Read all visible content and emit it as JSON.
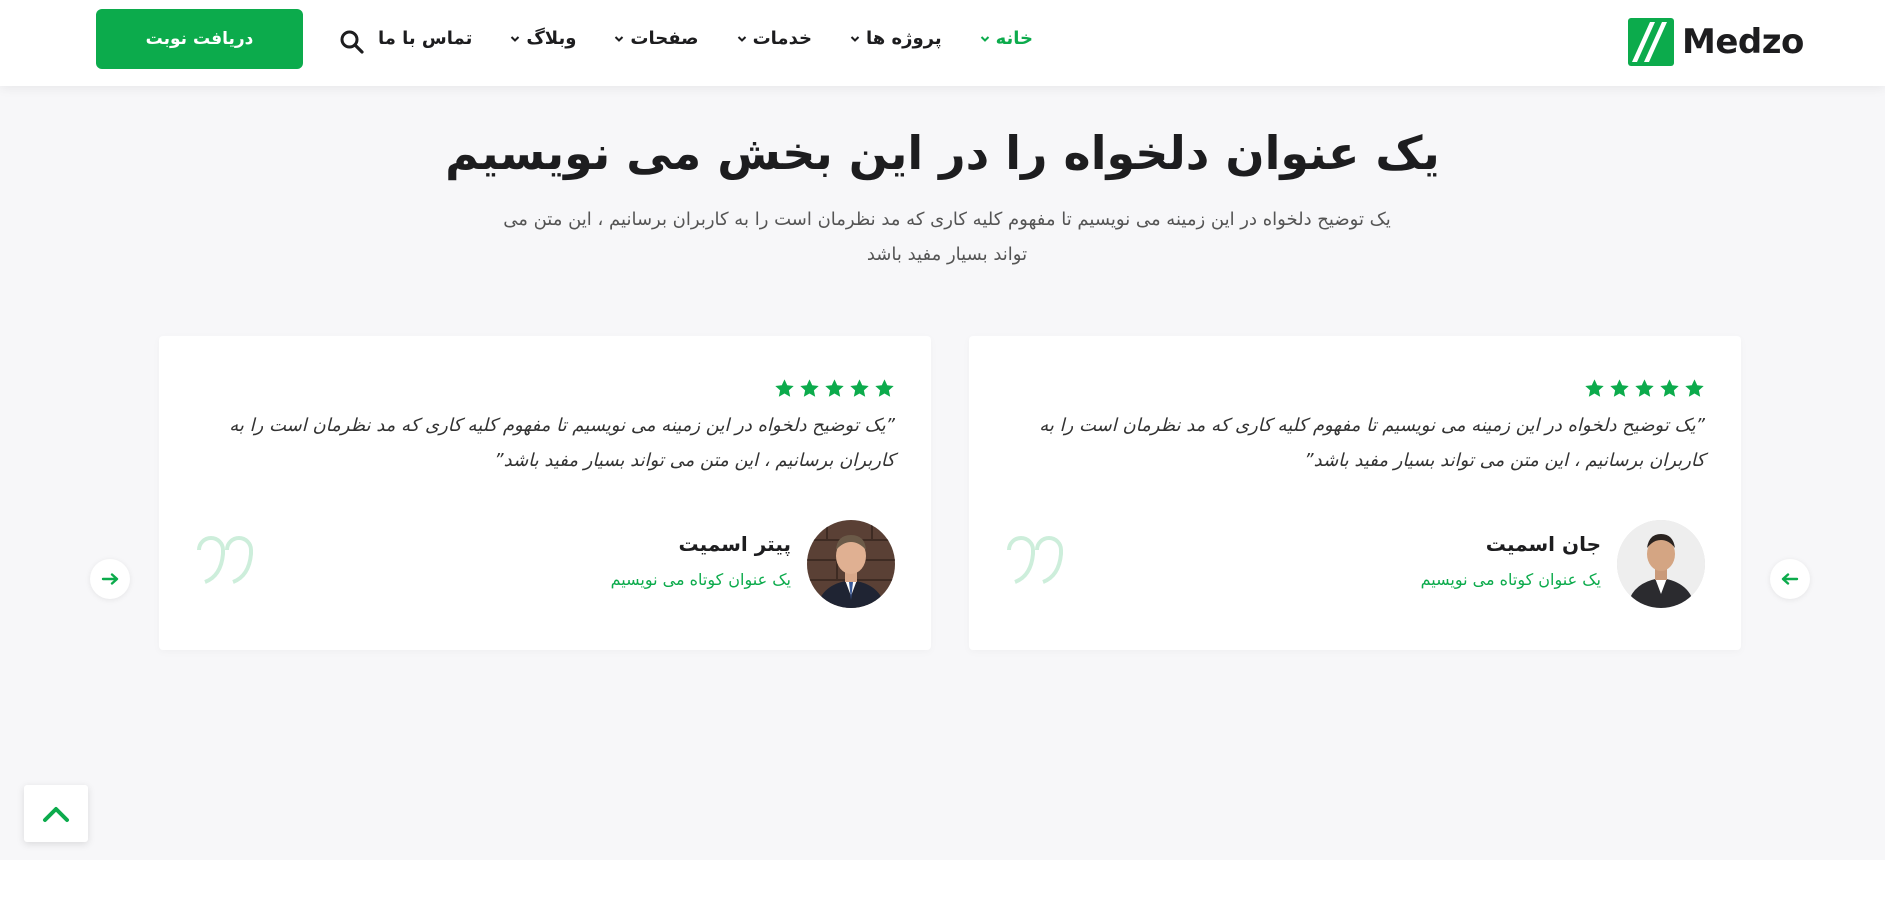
{
  "header": {
    "logo_text": "Medzo",
    "cta_label": "دریافت نوبت",
    "nav": [
      {
        "label": "خانه",
        "dropdown": true,
        "active": true
      },
      {
        "label": "پروژه ها",
        "dropdown": true,
        "active": false
      },
      {
        "label": "خدمات",
        "dropdown": true,
        "active": false
      },
      {
        "label": "صفحات",
        "dropdown": true,
        "active": false
      },
      {
        "label": "وبلاگ",
        "dropdown": true,
        "active": false
      },
      {
        "label": "تماس با ما",
        "dropdown": false,
        "active": false
      }
    ],
    "icons": {
      "search": "search-icon",
      "logo": "medzo-logo-mark"
    }
  },
  "section": {
    "title": "یک عنوان دلخواه را در این بخش می نویسیم",
    "subtitle": "یک توضیح دلخواه در این زمینه می نویسیم تا مفهوم کلیه کاری که مد نظرمان است را به کاربران برسانیم ، این متن می تواند بسیار مفید باشد"
  },
  "testimonials": [
    {
      "rating": 5,
      "quote": "”یک توضیح دلخواه در این زمینه می نویسیم تا مفهوم کلیه کاری که مد نظرمان است را به کاربران برسانیم ، این متن می تواند بسیار مفید باشد”",
      "name": "جان اسمیت",
      "role": "یک عنوان کوتاه می نویسیم"
    },
    {
      "rating": 5,
      "quote": "”یک توضیح دلخواه در این زمینه می نویسیم تا مفهوم کلیه کاری که مد نظرمان است را به کاربران برسانیم ، این متن می تواند بسیار مفید باشد”",
      "name": "پیتر اسمیت",
      "role": "یک عنوان کوتاه می نویسیم"
    }
  ],
  "colors": {
    "accent": "#0cab4c",
    "text_dark": "#1d1d1f",
    "section_bg": "#f7f7f9",
    "quote_mark": "#cdeedb"
  }
}
